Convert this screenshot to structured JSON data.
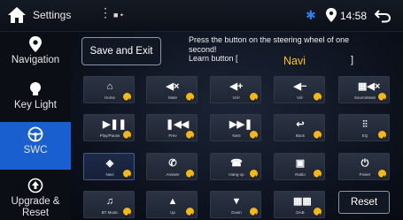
{
  "status": {
    "title": "Settings",
    "menu_icon": "vertical-dots-icon",
    "indicators": "■ •",
    "bluetooth": "✱",
    "time": "14:58"
  },
  "sidebar": {
    "items": [
      {
        "label": "Navigation",
        "icon": "location-pin-icon"
      },
      {
        "label": "Key Light",
        "icon": "bulb-icon"
      },
      {
        "label": "SWC",
        "icon": "steering-wheel-icon",
        "active": true
      },
      {
        "label": "Upgrade & Reset",
        "icon": "upgrade-icon"
      }
    ]
  },
  "learn": {
    "save_label": "Save and Exit",
    "instruction_line1": "Press the button on the steering wheel of one",
    "instruction_line2": "second!",
    "learn_prefix": "Learn button [",
    "learn_value": "Navi",
    "learn_suffix": "]"
  },
  "keys": [
    {
      "label": "Home",
      "icon": "home-icon",
      "glyph": "⌂"
    },
    {
      "label": "Mute",
      "icon": "mute-icon",
      "glyph": "◀×"
    },
    {
      "label": "Vol+",
      "icon": "volume-up-icon",
      "glyph": "◀+"
    },
    {
      "label": "Vol-",
      "icon": "volume-down-icon",
      "glyph": "◀−"
    },
    {
      "label": "SourceMute",
      "icon": "source-mute-icon",
      "glyph": "▦◀×"
    },
    {
      "label": "Play/Pause",
      "icon": "play-pause-icon",
      "glyph": "▶❚❚"
    },
    {
      "label": "Prev",
      "icon": "previous-icon",
      "glyph": "❚◀◀"
    },
    {
      "label": "Next",
      "icon": "next-icon",
      "glyph": "▶▶❚"
    },
    {
      "label": "Back",
      "icon": "back-icon",
      "glyph": "↩"
    },
    {
      "label": "EQ",
      "icon": "equalizer-icon",
      "glyph": "⫶⫶"
    },
    {
      "label": "Navi",
      "icon": "navigation-icon",
      "glyph": "◈",
      "selected": true
    },
    {
      "label": "Answer",
      "icon": "phone-answer-icon",
      "glyph": "✆"
    },
    {
      "label": "Hang-up",
      "icon": "phone-hangup-icon",
      "glyph": "☎"
    },
    {
      "label": "Radio",
      "icon": "radio-icon",
      "glyph": "▣"
    },
    {
      "label": "Power",
      "icon": "power-icon",
      "glyph": "⏻"
    },
    {
      "label": "BT Music",
      "icon": "music-icon",
      "glyph": "♫"
    },
    {
      "label": "Up",
      "icon": "up-arrow-icon",
      "glyph": "▲"
    },
    {
      "label": "Down",
      "icon": "down-arrow-icon",
      "glyph": "▼"
    },
    {
      "label": "DAB",
      "icon": "dab-icon",
      "glyph": "▦▦"
    }
  ],
  "reset_label": "Reset",
  "colors": {
    "accent": "#1a5fcf",
    "learn_value": "#ffc400",
    "check": "#f3b716",
    "bluetooth": "#2f7cf3"
  }
}
